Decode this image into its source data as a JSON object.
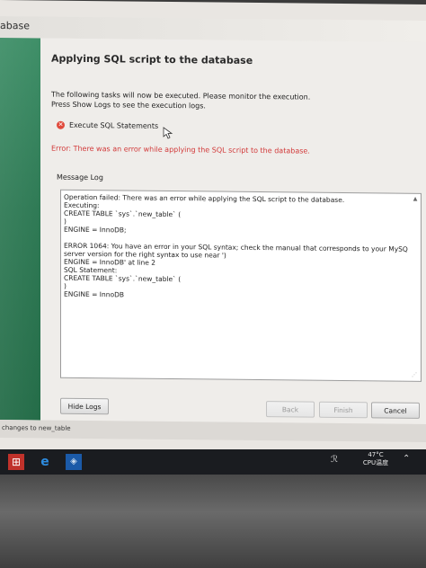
{
  "window": {
    "title_fragment": "abase"
  },
  "wizard": {
    "title": "Applying SQL script to the database",
    "intro_line1": "The following tasks will now be executed. Please monitor the execution.",
    "intro_line2": "Press Show Logs to see the execution logs.",
    "task_label": "Execute SQL Statements",
    "error_message": "Error: There was an error while applying the SQL script to the database.",
    "message_log_label": "Message Log",
    "message_log_text": "Operation failed: There was an error while applying the SQL script to the database.\nExecuting:\nCREATE TABLE `sys`.`new_table` (\n)\nENGINE = InnoDB;\n\nERROR 1064: You have an error in your SQL syntax; check the manual that corresponds to your MySQL\nserver version for the right syntax to use near ')\nENGINE = InnoDB' at line 2\nSQL Statement:\nCREATE TABLE `sys`.`new_table` (\n)\nENGINE = InnoDB",
    "buttons": {
      "hide_logs": "Hide Logs",
      "back": "Back",
      "finish": "Finish",
      "cancel": "Cancel"
    }
  },
  "status_bar": {
    "text": "changes to new_table"
  },
  "taskbar": {
    "tray_temp": "47°C",
    "tray_cpu": "CPU温度"
  },
  "colors": {
    "error_red": "#d23a3a",
    "rail_green": "#2f7a55",
    "taskbar": "#1a1c20"
  },
  "icons": [
    "error-x-icon",
    "mouse-cursor-icon",
    "scroll-up-icon",
    "resize-grip-icon",
    "start-icon",
    "edge-browser-icon",
    "mysql-workbench-icon",
    "network-icon",
    "tray-expand-icon"
  ]
}
